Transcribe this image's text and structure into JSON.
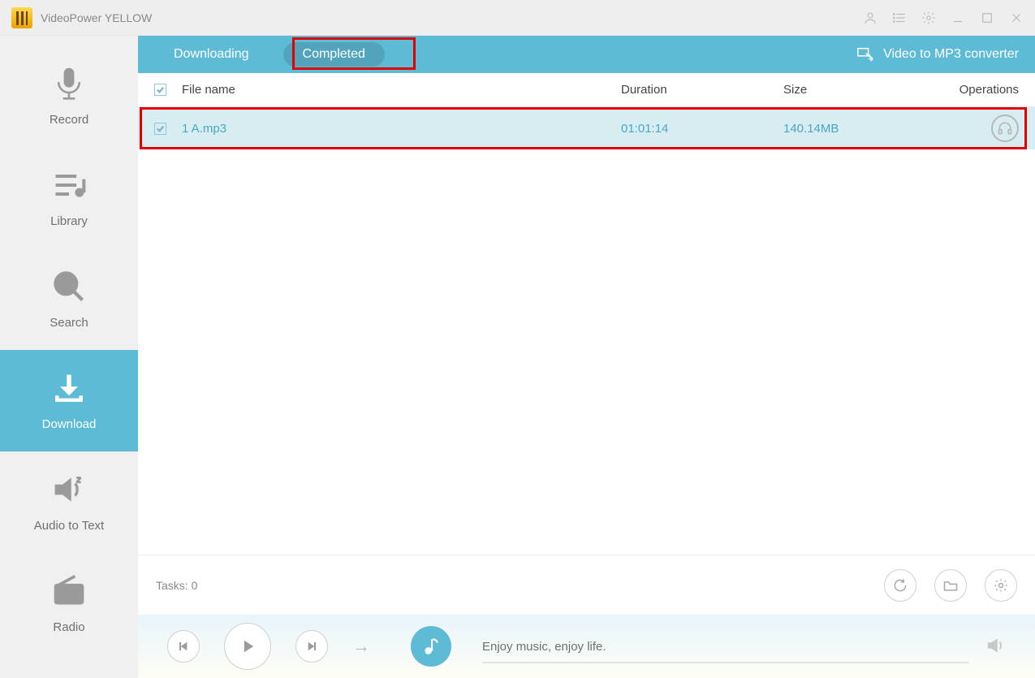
{
  "app": {
    "title": "VideoPower YELLOW"
  },
  "sidebar": {
    "items": [
      {
        "label": "Record"
      },
      {
        "label": "Library"
      },
      {
        "label": "Search"
      },
      {
        "label": "Download"
      },
      {
        "label": "Audio to Text"
      },
      {
        "label": "Radio"
      }
    ]
  },
  "tabs": {
    "downloading": "Downloading",
    "completed": "Completed",
    "converter": "Video to MP3 converter"
  },
  "table": {
    "headers": {
      "name": "File name",
      "duration": "Duration",
      "size": "Size",
      "ops": "Operations"
    },
    "rows": [
      {
        "name": "1 A.mp3",
        "duration": "01:01:14",
        "size": "140.14MB"
      }
    ]
  },
  "footer": {
    "tasks": "Tasks: 0"
  },
  "player": {
    "message": "Enjoy music, enjoy life."
  }
}
